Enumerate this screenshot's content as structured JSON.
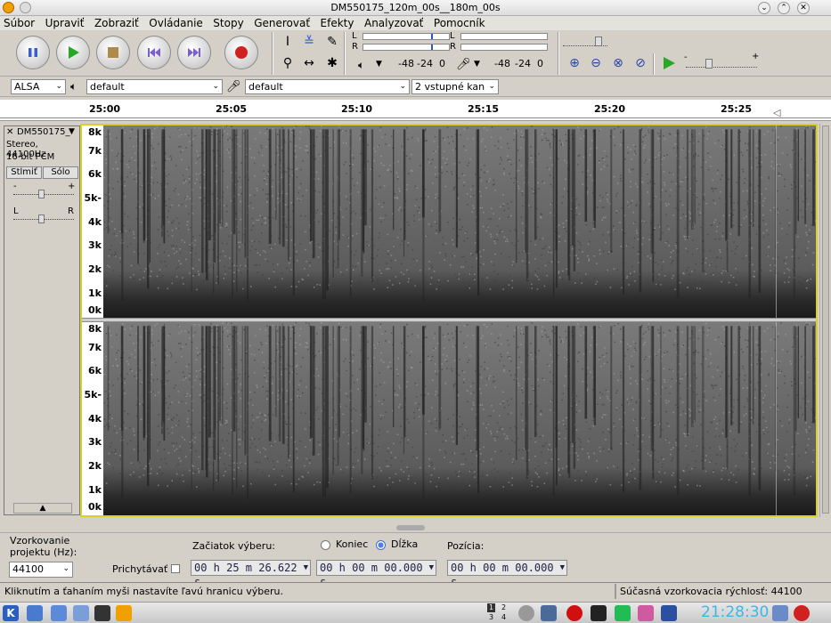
{
  "window": {
    "title": "DM550175_120m_00s__180m_00s"
  },
  "menu": [
    "Súbor",
    "Upraviť",
    "Zobraziť",
    "Ovládanie",
    "Stopy",
    "Generovať",
    "Efekty",
    "Analyzovať",
    "Pomocník"
  ],
  "meters": {
    "play_scale": [
      "-48",
      "-24",
      "0"
    ],
    "rec_scale": [
      "-48",
      "-24",
      "0"
    ],
    "left_label": "L",
    "right_label": "R"
  },
  "devices": {
    "host": "ALSA",
    "output": "default",
    "input": "default",
    "channels": "2 vstupné kan"
  },
  "ruler": [
    "25:00",
    "25:05",
    "25:10",
    "25:15",
    "25:20",
    "25:25"
  ],
  "track": {
    "name": "DM550175_",
    "info1": "Stereo, 44100Hz",
    "info2": "16-bit PCM",
    "mute": "Stlmiť",
    "solo": "Sólo",
    "gain_minus": "-",
    "gain_plus": "+",
    "pan_l": "L",
    "pan_r": "R"
  },
  "spectrogram_labels": [
    "8k",
    "7k",
    "6k",
    "5k-",
    "4k",
    "3k",
    "2k",
    "1k",
    "0k"
  ],
  "selection": {
    "rate_label_1": "Vzorkovanie",
    "rate_label_2": "projektu (Hz):",
    "rate_value": "44100",
    "snap_label": "Prichytávať",
    "start_label": "Začiatok výberu:",
    "end_label": "Koniec",
    "length_label": "Dĺžka",
    "position_label": "Pozícia:",
    "start_value": "00 h 25 m 26.622 s",
    "length_value": "00 h 00 m 00.000 s",
    "position_value": "00 h 00 m 00.000 s"
  },
  "status": {
    "hint": "Kliknutím a ťahaním myši nastavíte ľavú hranicu výberu.",
    "rate": "Súčasná vzorkovacia rýchlosť: 44100"
  },
  "taskbar": {
    "clock": "21:28:30",
    "desktops": [
      "1",
      "2",
      "3",
      "4"
    ]
  }
}
